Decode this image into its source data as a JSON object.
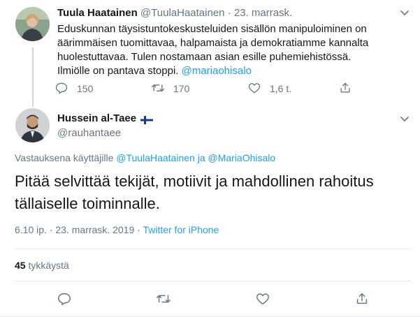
{
  "parent": {
    "name": "Tuula Haatainen",
    "handle": "@TuulaHaatainen",
    "separator": "·",
    "date": "23. marrask.",
    "text": "Eduskunnan täysistuntokeskusteluiden sisällön manipuloiminen on äärimmäisen tuomittavaa, halpamaista ja demokratiamme kannalta huolestuttavaa. Tulen nostamaan asian esille puhemiehistössä. Ilmiölle on pantava stoppi.",
    "mention": "@mariaohisalo",
    "reply_count": "150",
    "retweet_count": "170",
    "like_count": "1,6 t."
  },
  "main": {
    "name": "Hussein al-Taee",
    "handle": "@rauhantaee",
    "reply_prefix": "Vastauksena käyttäjille",
    "reply_user1": "@TuulaHaatainen",
    "reply_and": "ja",
    "reply_user2": "@MariaOhisalo",
    "text": "Pitää selvittää tekijät, motiivit ja mahdollinen rahoitus tällaiselle toiminnalle.",
    "time": "6.10 ip.",
    "separator": "·",
    "date": "23. marrask. 2019",
    "source": "Twitter for iPhone",
    "likes_count": "45",
    "likes_label": "tykkäystä"
  },
  "colors": {
    "accent": "#1da1f2",
    "muted": "#657786",
    "text": "#14171a"
  },
  "icons": {
    "reply": "reply-icon",
    "retweet": "retweet-icon",
    "like": "heart-icon",
    "share": "share-icon",
    "more": "chevron-down-icon",
    "flag": "finland-flag-icon"
  }
}
